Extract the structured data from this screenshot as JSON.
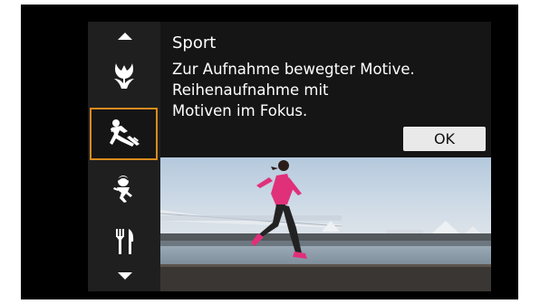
{
  "mode": {
    "title": "Sport",
    "description_lines": [
      "Zur Aufnahme bewegter Motive.",
      "Reihenaufnahme mit",
      "Motiven im Fokus."
    ],
    "ok_label": "OK"
  },
  "mode_list": [
    {
      "icon": "macro-flower-icon",
      "selected": false
    },
    {
      "icon": "sports-runner-icon",
      "selected": true
    },
    {
      "icon": "kids-icon",
      "selected": false
    },
    {
      "icon": "food-icon",
      "selected": false
    }
  ],
  "colors": {
    "selection_border": "#d98b1e",
    "ok_button_bg": "#e9e9e9"
  }
}
